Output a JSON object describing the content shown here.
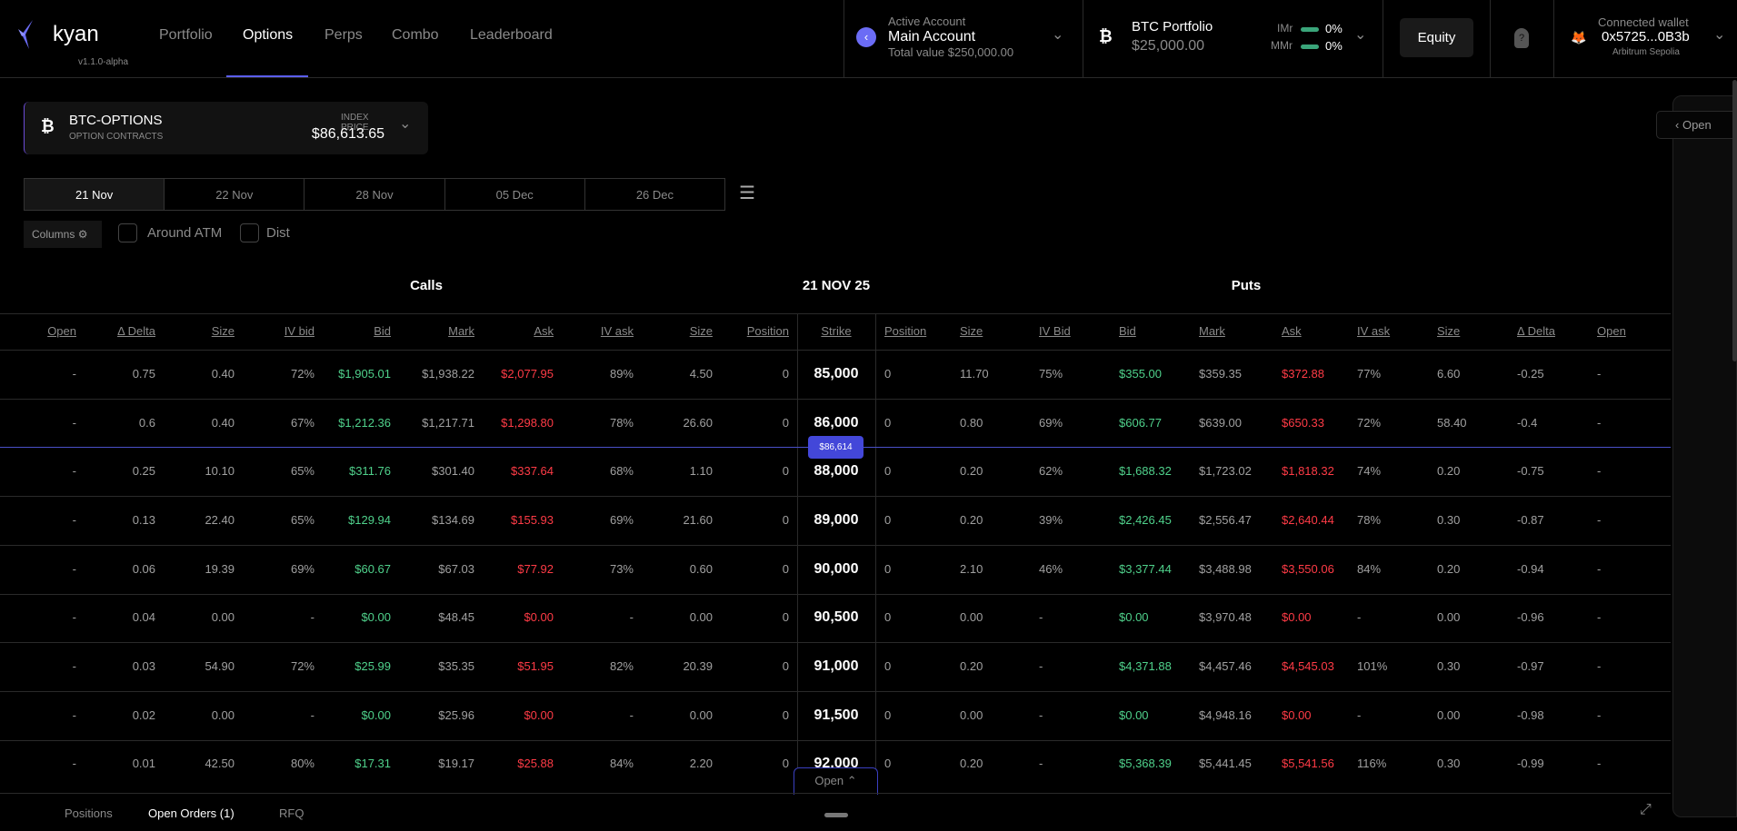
{
  "header": {
    "logo": "kyan",
    "version": "v1.1.0-alpha",
    "nav": [
      "Portfolio",
      "Options",
      "Perps",
      "Combo",
      "Leaderboard"
    ],
    "active_nav": "Options",
    "account": {
      "label": "Active Account",
      "name": "Main Account",
      "total": "Total value $250,000.00"
    },
    "portfolio": {
      "name": "BTC Portfolio",
      "value": "$25,000.00",
      "imr_label": "IMr",
      "imr": "0%",
      "mmr_label": "MMr",
      "mmr": "0%"
    },
    "equity": "Equity",
    "wallet": {
      "label": "Connected wallet",
      "address": "0x5725...0B3b",
      "network": "Arbitrum Sepolia"
    }
  },
  "market": {
    "name": "BTC-OPTIONS",
    "sub": "OPTION CONTRACTS",
    "index_label": "INDEX PRICE",
    "index_price": "$86,613.65"
  },
  "expiries": [
    "21 Nov",
    "22 Nov",
    "28 Nov",
    "05 Dec",
    "26 Dec"
  ],
  "filters": {
    "columns": "Columns",
    "around_atm": "Around ATM",
    "dist": "Dist"
  },
  "table": {
    "calls_title": "Calls",
    "expiry_title": "21 NOV 25",
    "puts_title": "Puts",
    "call_headers": [
      "Open",
      "Δ Delta",
      "Size",
      "IV bid",
      "Bid",
      "Mark",
      "Ask",
      "IV ask",
      "Size",
      "Position"
    ],
    "strike_header": "Strike",
    "put_headers": [
      "Position",
      "Size",
      "IV Bid",
      "Bid",
      "Mark",
      "Ask",
      "IV ask",
      "Size",
      "Δ Delta",
      "Open"
    ],
    "index_marker": "$86,614",
    "rows": [
      {
        "call": [
          "-",
          "0.75",
          "0.40",
          "72%",
          "$1,905.01",
          "$1,938.22",
          "$2,077.95",
          "89%",
          "4.50",
          "0"
        ],
        "strike": "85,000",
        "put": [
          "0",
          "11.70",
          "75%",
          "$355.00",
          "$359.35",
          "$372.88",
          "77%",
          "6.60",
          "-0.25",
          "-"
        ]
      },
      {
        "call": [
          "-",
          "0.6",
          "0.40",
          "67%",
          "$1,212.36",
          "$1,217.71",
          "$1,298.80",
          "78%",
          "26.60",
          "0"
        ],
        "strike": "86,000",
        "put": [
          "0",
          "0.80",
          "69%",
          "$606.77",
          "$639.00",
          "$650.33",
          "72%",
          "58.40",
          "-0.4",
          "-"
        ]
      },
      {
        "call": [
          "-",
          "0.25",
          "10.10",
          "65%",
          "$311.76",
          "$301.40",
          "$337.64",
          "68%",
          "1.10",
          "0"
        ],
        "strike": "88,000",
        "put": [
          "0",
          "0.20",
          "62%",
          "$1,688.32",
          "$1,723.02",
          "$1,818.32",
          "74%",
          "0.20",
          "-0.75",
          "-"
        ]
      },
      {
        "call": [
          "-",
          "0.13",
          "22.40",
          "65%",
          "$129.94",
          "$134.69",
          "$155.93",
          "69%",
          "21.60",
          "0"
        ],
        "strike": "89,000",
        "put": [
          "0",
          "0.20",
          "39%",
          "$2,426.45",
          "$2,556.47",
          "$2,640.44",
          "78%",
          "0.30",
          "-0.87",
          "-"
        ]
      },
      {
        "call": [
          "-",
          "0.06",
          "19.39",
          "69%",
          "$60.67",
          "$67.03",
          "$77.92",
          "73%",
          "0.60",
          "0"
        ],
        "strike": "90,000",
        "put": [
          "0",
          "2.10",
          "46%",
          "$3,377.44",
          "$3,488.98",
          "$3,550.06",
          "84%",
          "0.20",
          "-0.94",
          "-"
        ]
      },
      {
        "call": [
          "-",
          "0.04",
          "0.00",
          "-",
          "$0.00",
          "$48.45",
          "$0.00",
          "-",
          "0.00",
          "0"
        ],
        "strike": "90,500",
        "put": [
          "0",
          "0.00",
          "-",
          "$0.00",
          "$3,970.48",
          "$0.00",
          "-",
          "0.00",
          "-0.96",
          "-"
        ]
      },
      {
        "call": [
          "-",
          "0.03",
          "54.90",
          "72%",
          "$25.99",
          "$35.35",
          "$51.95",
          "82%",
          "20.39",
          "0"
        ],
        "strike": "91,000",
        "put": [
          "0",
          "0.20",
          "-",
          "$4,371.88",
          "$4,457.46",
          "$4,545.03",
          "101%",
          "0.30",
          "-0.97",
          "-"
        ]
      },
      {
        "call": [
          "-",
          "0.02",
          "0.00",
          "-",
          "$0.00",
          "$25.96",
          "$0.00",
          "-",
          "0.00",
          "0"
        ],
        "strike": "91,500",
        "put": [
          "0",
          "0.00",
          "-",
          "$0.00",
          "$4,948.16",
          "$0.00",
          "-",
          "0.00",
          "-0.98",
          "-"
        ]
      },
      {
        "call": [
          "-",
          "0.01",
          "42.50",
          "80%",
          "$17.31",
          "$19.17",
          "$25.88",
          "84%",
          "2.20",
          "0"
        ],
        "strike": "92,000",
        "put": [
          "0",
          "0.20",
          "-",
          "$5,368.39",
          "$5,441.45",
          "$5,541.56",
          "116%",
          "0.30",
          "-0.99",
          "-"
        ]
      }
    ]
  },
  "bottom": {
    "tabs": [
      "Positions",
      "Open Orders (1)",
      "RFQ"
    ],
    "open_toggle": "Open"
  },
  "side": {
    "open": "Open"
  },
  "colors": {
    "accent": "#5b5ef0",
    "bid": "#4fd18b",
    "ask": "#ff3b46"
  }
}
